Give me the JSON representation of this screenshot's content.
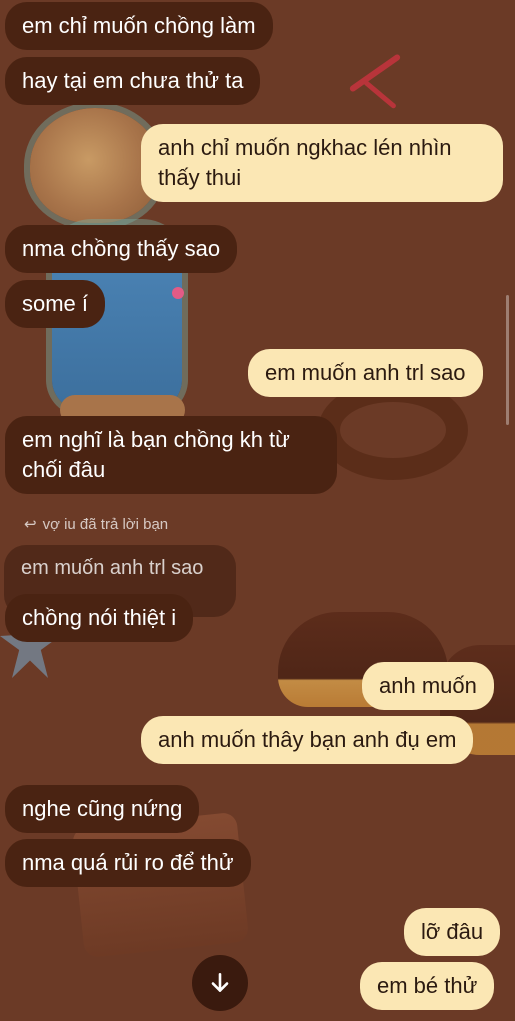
{
  "messages": [
    {
      "text": "em chỉ muốn chồng làm",
      "dir": "in"
    },
    {
      "text": "hay tại em chưa thử ta",
      "dir": "in"
    },
    {
      "text": "anh chỉ muốn ngkhac lén nhìn thấy thui",
      "dir": "out"
    },
    {
      "text": "nma chồng thấy sao",
      "dir": "in"
    },
    {
      "text": "some í",
      "dir": "in"
    },
    {
      "text": "em muốn anh trl sao",
      "dir": "out"
    },
    {
      "text": "em nghĩ là bạn chồng kh từ chối đâu",
      "dir": "in"
    },
    {
      "text": "chồng nói thiệt i",
      "dir": "in"
    },
    {
      "text": "anh muốn",
      "dir": "out"
    },
    {
      "text": "anh muốn thây bạn anh đụ em",
      "dir": "out"
    },
    {
      "text": "nghe cũng nứng",
      "dir": "in"
    },
    {
      "text": "nma quá rủi ro để thử",
      "dir": "in"
    },
    {
      "text": "lỡ đâu",
      "dir": "out"
    },
    {
      "text": "em bé thử",
      "dir": "out"
    }
  ],
  "reply": {
    "indicator": "vợ iu đã trả lời bạn",
    "quoted": "em muốn anh trl sao"
  },
  "icons": {
    "reply": "reply-arrow-icon",
    "jump": "arrow-down-icon"
  },
  "colors": {
    "background": "#6b3a26",
    "incoming_bubble": "#4a2312",
    "outgoing_bubble": "#fbe7b4",
    "outgoing_text": "#2b1a10"
  }
}
